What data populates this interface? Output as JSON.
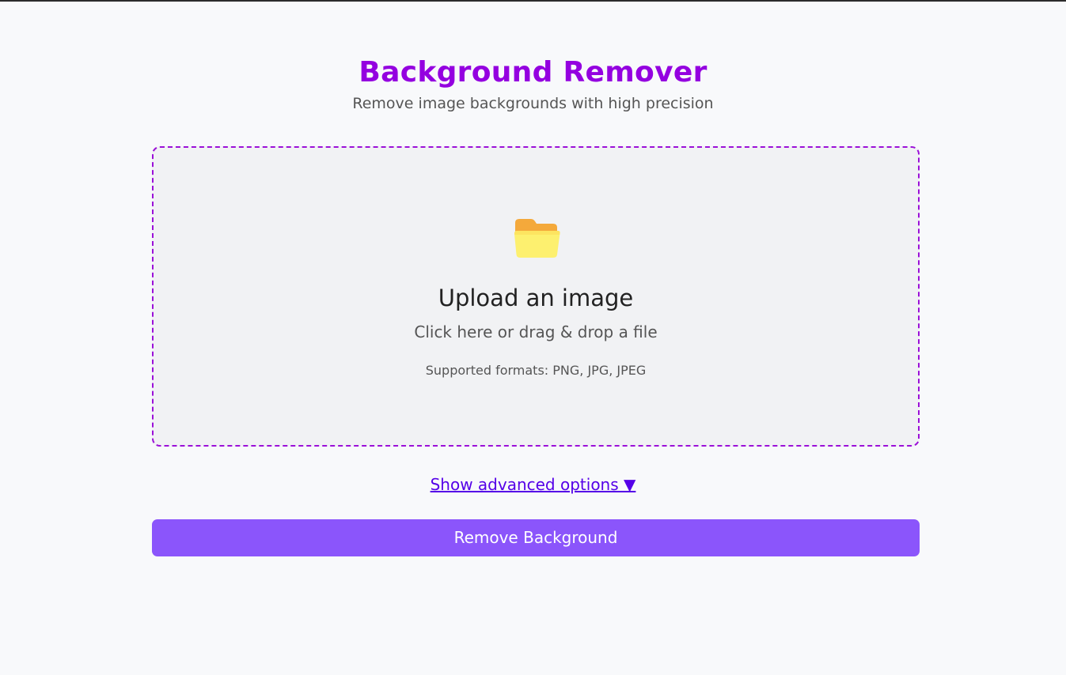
{
  "header": {
    "title": "Background Remover",
    "subtitle": "Remove image backgrounds with high precision"
  },
  "upload": {
    "icon": "folder-icon",
    "title": "Upload an image",
    "hint": "Click here or drag & drop a file",
    "formats": "Supported formats: PNG, JPG, JPEG"
  },
  "advanced": {
    "label": "Show advanced options ▼"
  },
  "actions": {
    "remove_label": "Remove Background"
  },
  "colors": {
    "accent": "#9400e0",
    "button": "#8b55fb",
    "link": "#5500e8",
    "dropzone_border": "#9b10d8"
  }
}
